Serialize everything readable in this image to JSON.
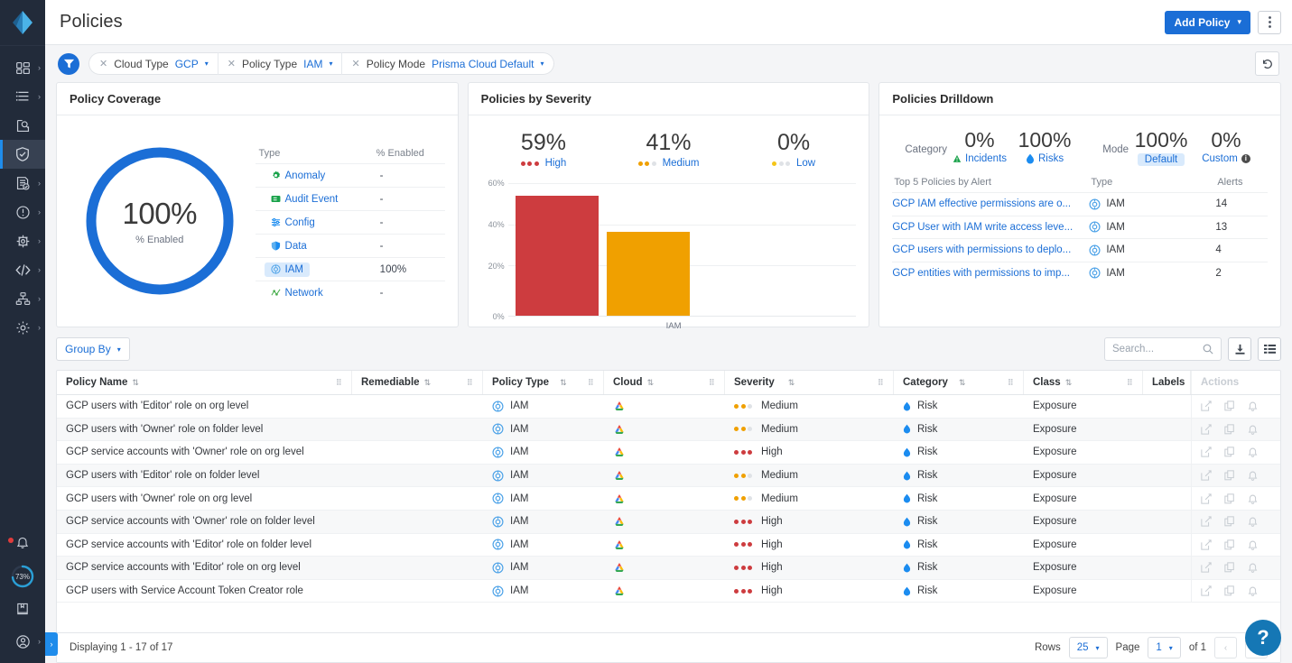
{
  "header": {
    "title": "Policies",
    "add_policy_label": "Add Policy",
    "kebab_icon": "kebab-menu-icon"
  },
  "filters": {
    "funnel_icon": "funnel-icon",
    "reset_icon": "reset-icon",
    "pills": [
      {
        "label": "Cloud Type",
        "value": "GCP"
      },
      {
        "label": "Policy Type",
        "value": "IAM"
      },
      {
        "label": "Policy Mode",
        "value": "Prisma Cloud Default"
      }
    ]
  },
  "sidebar": {
    "items": [
      {
        "name": "dashboard-icon",
        "chevron": true
      },
      {
        "name": "list-icon",
        "chevron": true
      },
      {
        "name": "investigate-icon",
        "chevron": false
      },
      {
        "name": "shield-icon",
        "chevron": false,
        "active": true
      },
      {
        "name": "compliance-icon",
        "chevron": true
      },
      {
        "name": "alerts-icon",
        "chevron": true
      },
      {
        "name": "settings-gear-icon",
        "chevron": true
      },
      {
        "name": "code-icon",
        "chevron": true
      },
      {
        "name": "topology-icon",
        "chevron": true
      },
      {
        "name": "gear-icon",
        "chevron": true
      }
    ],
    "bottom": {
      "bell_icon": "bell-icon",
      "usage_percent": "73%",
      "docs_icon": "book-icon",
      "profile_icon": "user-icon",
      "expander_icon": "chevron-right-icon"
    }
  },
  "coverage": {
    "title": "Policy Coverage",
    "donut_value": "100%",
    "donut_label": "% Enabled",
    "col_type": "Type",
    "col_enabled": "% Enabled",
    "rows": [
      {
        "type": "Anomaly",
        "icon": "anomaly-icon",
        "color": "#19a24a",
        "value": "-",
        "selected": false
      },
      {
        "type": "Audit Event",
        "icon": "audit-event-icon",
        "color": "#19a24a",
        "value": "-",
        "selected": false
      },
      {
        "type": "Config",
        "icon": "config-icon",
        "color": "#1b8cf0",
        "value": "-",
        "selected": false
      },
      {
        "type": "Data",
        "icon": "data-icon",
        "color": "#1b8cf0",
        "value": "-",
        "selected": false
      },
      {
        "type": "IAM",
        "icon": "iam-icon",
        "color": "#5eb0ef",
        "value": "100%",
        "selected": true
      },
      {
        "type": "Network",
        "icon": "network-icon",
        "color": "#4caf50",
        "value": "-",
        "selected": false
      }
    ]
  },
  "severity": {
    "title": "Policies by Severity",
    "stats": [
      {
        "value": "59%",
        "label": "High",
        "dots": 3,
        "color": "#cd3c3f"
      },
      {
        "value": "41%",
        "label": "Medium",
        "dots": 2,
        "color": "#f0a000"
      },
      {
        "value": "0%",
        "label": "Low",
        "dots": 1,
        "color": "#f5c518"
      }
    ]
  },
  "chart_data": {
    "type": "bar",
    "title": "Policies by Severity",
    "categories": [
      "IAM"
    ],
    "series": [
      {
        "name": "High",
        "values": [
          59
        ],
        "color": "#cd3c3f"
      },
      {
        "name": "Medium",
        "values": [
          41
        ],
        "color": "#f0a000"
      }
    ],
    "xlabel": "",
    "ylabel": "",
    "ylim": [
      0,
      65
    ],
    "yticks": [
      "0%",
      "20%",
      "40%",
      "60%"
    ],
    "ytick_values": [
      0,
      20,
      40,
      60
    ],
    "grid": true,
    "legend_position": "top"
  },
  "drilldown": {
    "title": "Policies Drilldown",
    "category_caption": "Category",
    "mode_caption": "Mode",
    "category_stats": [
      {
        "value": "0%",
        "label": "Incidents",
        "icon": "incident-icon",
        "color": "#19a24a",
        "chip": false
      },
      {
        "value": "100%",
        "label": "Risks",
        "icon": "risk-icon",
        "color": "#1b8cf0",
        "chip": false
      }
    ],
    "mode_stats": [
      {
        "value": "100%",
        "label": "Default",
        "chip": true,
        "info": false
      },
      {
        "value": "0%",
        "label": "Custom",
        "chip": false,
        "info": true
      }
    ],
    "table_headers": {
      "policy": "Top 5 Policies by Alert",
      "type": "Type",
      "alerts": "Alerts"
    },
    "rows": [
      {
        "policy": "GCP IAM effective permissions are o...",
        "type": "IAM",
        "alerts": "14"
      },
      {
        "policy": "GCP User with IAM write access leve...",
        "type": "IAM",
        "alerts": "13"
      },
      {
        "policy": "GCP users with permissions to deplo...",
        "type": "IAM",
        "alerts": "4"
      },
      {
        "policy": "GCP entities with permissions to imp...",
        "type": "IAM",
        "alerts": "2"
      }
    ]
  },
  "table": {
    "group_by_label": "Group By",
    "search_placeholder": "Search...",
    "search_value": "",
    "search_icon": "search-icon",
    "download_icon": "download-icon",
    "columns_icon": "columns-icon",
    "headers": [
      {
        "label": "Policy Name",
        "sortable": true,
        "grip": true
      },
      {
        "label": "Remediable",
        "sortable": true,
        "grip": true
      },
      {
        "label": "Policy Type",
        "sortable": true,
        "grip": true
      },
      {
        "label": "Cloud",
        "sortable": true,
        "grip": true
      },
      {
        "label": "Severity",
        "sortable": true,
        "grip": true
      },
      {
        "label": "Category",
        "sortable": true,
        "grip": true
      },
      {
        "label": "Class",
        "sortable": true,
        "grip": true
      },
      {
        "label": "Labels",
        "sortable": false,
        "grip": true
      },
      {
        "label": "Actions",
        "sortable": false,
        "grip": false
      }
    ],
    "rows": [
      {
        "name": "GCP users with 'Editor' role on org level",
        "remediable": "",
        "policy_type": "IAM",
        "cloud": "gcp",
        "severity": "Medium",
        "sev_dots": 2,
        "category": "Risk",
        "class": "Exposure",
        "labels": ""
      },
      {
        "name": "GCP users with 'Owner' role on folder level",
        "remediable": "",
        "policy_type": "IAM",
        "cloud": "gcp",
        "severity": "Medium",
        "sev_dots": 2,
        "category": "Risk",
        "class": "Exposure",
        "labels": ""
      },
      {
        "name": "GCP service accounts with 'Owner' role on org level",
        "remediable": "",
        "policy_type": "IAM",
        "cloud": "gcp",
        "severity": "High",
        "sev_dots": 3,
        "category": "Risk",
        "class": "Exposure",
        "labels": ""
      },
      {
        "name": "GCP users with 'Editor' role on folder level",
        "remediable": "",
        "policy_type": "IAM",
        "cloud": "gcp",
        "severity": "Medium",
        "sev_dots": 2,
        "category": "Risk",
        "class": "Exposure",
        "labels": ""
      },
      {
        "name": "GCP users with 'Owner' role on org level",
        "remediable": "",
        "policy_type": "IAM",
        "cloud": "gcp",
        "severity": "Medium",
        "sev_dots": 2,
        "category": "Risk",
        "class": "Exposure",
        "labels": ""
      },
      {
        "name": "GCP service accounts with 'Owner' role on folder level",
        "remediable": "",
        "policy_type": "IAM",
        "cloud": "gcp",
        "severity": "High",
        "sev_dots": 3,
        "category": "Risk",
        "class": "Exposure",
        "labels": ""
      },
      {
        "name": "GCP service accounts with 'Editor' role on folder level",
        "remediable": "",
        "policy_type": "IAM",
        "cloud": "gcp",
        "severity": "High",
        "sev_dots": 3,
        "category": "Risk",
        "class": "Exposure",
        "labels": ""
      },
      {
        "name": "GCP service accounts with 'Editor' role on org level",
        "remediable": "",
        "policy_type": "IAM",
        "cloud": "gcp",
        "severity": "High",
        "sev_dots": 3,
        "category": "Risk",
        "class": "Exposure",
        "labels": ""
      },
      {
        "name": "GCP users with Service Account Token Creator role",
        "remediable": "",
        "policy_type": "IAM",
        "cloud": "gcp",
        "severity": "High",
        "sev_dots": 3,
        "category": "Risk",
        "class": "Exposure",
        "labels": ""
      }
    ],
    "row_actions": [
      "edit-icon",
      "clone-icon",
      "alert-bell-icon"
    ],
    "footer": {
      "displaying": "Displaying 1 - 17 of 17",
      "rows_label": "Rows",
      "rows_value": "25",
      "page_label": "Page",
      "page_value": "1",
      "of_label": "of 1",
      "prev_icon": "chevron-left-icon",
      "next_icon": "chevron-right-icon"
    }
  },
  "help": {
    "label": "?"
  },
  "colors": {
    "accent": "#1b6ed6",
    "high": "#cd3c3f",
    "medium": "#f0a000",
    "low": "#f5c518",
    "donut": "#1b6ed6",
    "sidebar_bg": "#222b3a"
  }
}
